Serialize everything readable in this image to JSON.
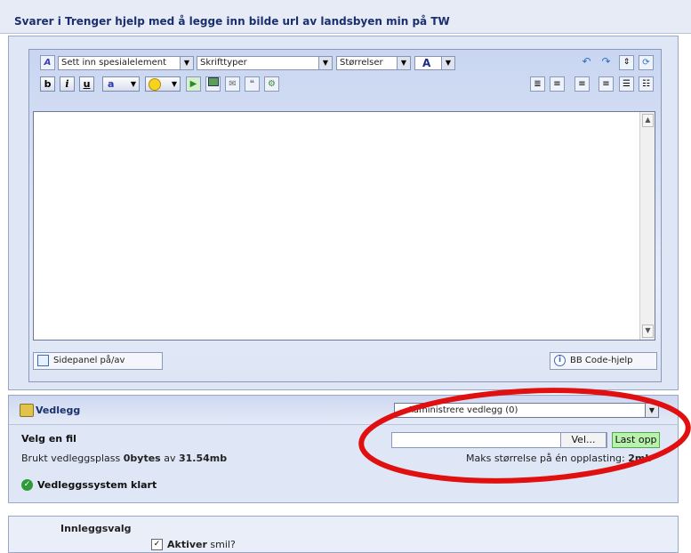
{
  "header": {
    "title": "Svarer i Trenger hjelp med å legge inn bilde url av landsbyen min på TW"
  },
  "toolbar": {
    "special_select": "Sett inn spesialelement",
    "font_select": "Skrifttyper",
    "size_select": "Størrelser",
    "bold": "b",
    "italic": "i",
    "underline": "u",
    "color": "a",
    "font_color": "A"
  },
  "editor": {
    "sidepanel_label": "Sidepanel på/av",
    "bbcode_label": "BB Code-hjelp"
  },
  "attachments": {
    "title": "Vedlegg",
    "manage_select": "Administrere vedlegg (0)",
    "choose_file": "Velg en fil",
    "browse_label": "Vel...",
    "upload_label": "Last opp",
    "used_prefix": "Brukt vedleggsplass",
    "used_value": "0bytes",
    "used_of": "av",
    "used_total": "31.54mb",
    "max_prefix": "Maks størrelse på én opplasting:",
    "max_value": "2mb",
    "status": "Vedleggssystem klart"
  },
  "options": {
    "title": "Innleggsvalg",
    "smilies_bold": "Aktiver",
    "smilies_rest": "smil?"
  },
  "colors": {
    "annotation": "#e01010",
    "title_blue": "#1a2f6e",
    "panel_bg": "#dfe6f5"
  }
}
